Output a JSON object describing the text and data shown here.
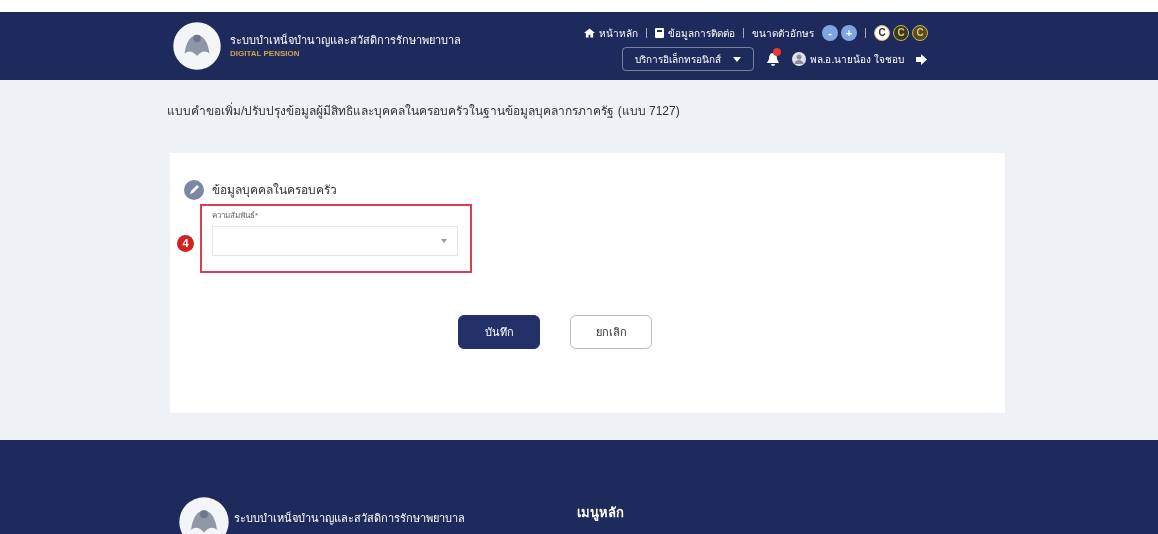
{
  "header": {
    "title": "ระบบบำเหน็จบำนาญและสวัสดิการรักษาพยาบาล",
    "subtitle": "DIGITAL PENSION",
    "top_links": [
      {
        "kind": "home",
        "label": "หน้าหลัก"
      },
      {
        "kind": "contact",
        "label": "ข้อมูลการติดต่อ"
      },
      {
        "kind": "fontsize",
        "label": "ขนาดตัวอักษร"
      }
    ],
    "font_buttons": [
      "-",
      "+"
    ],
    "contrast_buttons": [
      {
        "label": "C",
        "color": "#ffffff"
      },
      {
        "label": "C",
        "color": "#3a3a1a"
      },
      {
        "label": "C",
        "color": "#5a4a20"
      }
    ],
    "services_dropdown": "บริการอิเล็กทรอนิกส์",
    "notification_badge": true,
    "user_name": "พล.อ.นายน้อง ใจชอบ"
  },
  "page_title": "แบบคำขอเพิ่ม/ปรับปรุงข้อมูลผู้มีสิทธิและบุคคลในครอบครัวในฐานข้อมูลบุคลากรภาครัฐ (แบบ 7127)",
  "form": {
    "section_title": "ข้อมูลบุคคลในครอบครัว",
    "step_marker": "4",
    "field": {
      "label": "ความสัมพันธ์*",
      "highlighted": true
    },
    "buttons": [
      {
        "kind": "primary",
        "label": "บันทึก"
      },
      {
        "kind": "secondary",
        "label": "ยกเลิก"
      }
    ]
  },
  "footer": {
    "title": "ระบบบำเหน็จบำนาญและสวัสดิการรักษาพยาบาล",
    "menu_heading": "เมนูหลัก"
  }
}
